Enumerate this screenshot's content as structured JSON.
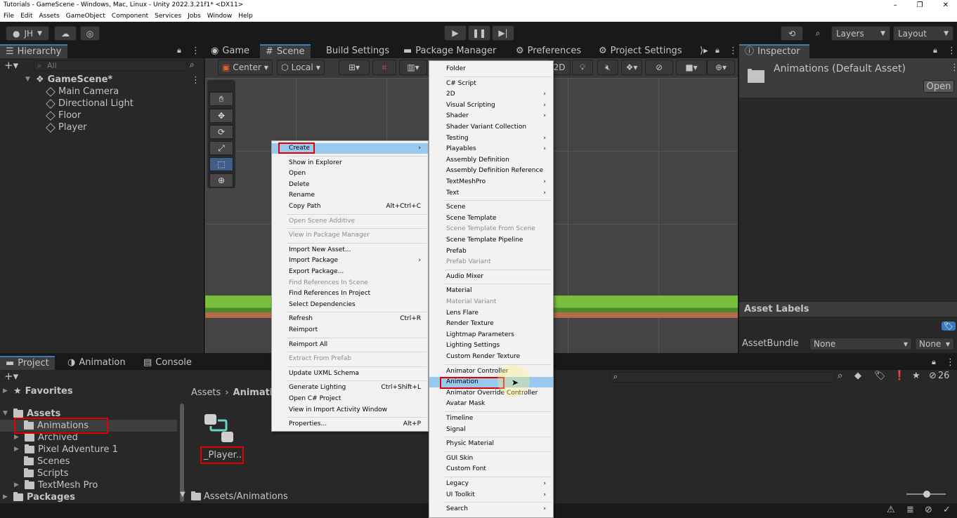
{
  "window": {
    "title": "Tutorials - GameScene - Windows, Mac, Linux - Unity 2022.3.21f1* <DX11>",
    "controls": [
      "–",
      "❐",
      "✕"
    ]
  },
  "menubar": [
    "File",
    "Edit",
    "Assets",
    "GameObject",
    "Component",
    "Services",
    "Jobs",
    "Window",
    "Help"
  ],
  "toolbar": {
    "account": "JH",
    "layers": "Layers",
    "layout": "Layout"
  },
  "hierarchy": {
    "tab": "Hierarchy",
    "search_placeholder": "All",
    "scene": "GameScene*",
    "items": [
      "Main Camera",
      "Directional Light",
      "Floor",
      "Player"
    ]
  },
  "center_tabs": [
    "Game",
    "Scene",
    "Build Settings",
    "Package Manager",
    "Preferences",
    "Project Settings"
  ],
  "scene_toolbar": {
    "pivot": "Center",
    "space": "Local",
    "mode2d": "2D"
  },
  "inspector": {
    "tab": "Inspector",
    "asset_title": "Animations (Default Asset)",
    "open_button": "Open",
    "asset_labels": "Asset Labels",
    "asset_bundle_label": "AssetBundle",
    "bundle_value": "None",
    "variant_value": "None"
  },
  "bottom_tabs": [
    "Project",
    "Animation",
    "Console"
  ],
  "project": {
    "favorites": "Favorites",
    "assets": "Assets",
    "packages": "Packages",
    "folders": [
      "Animations",
      "Archived",
      "Pixel Adventure 1",
      "Scenes",
      "Scripts",
      "TextMesh Pro"
    ],
    "breadcrumb_root": "Assets",
    "breadcrumb_current": "Animatio",
    "asset_name": "_Player...",
    "footer_path": "Assets/Animations",
    "hidden_count": "26"
  },
  "context_menu": [
    {
      "label": "Create",
      "shortcut": "›",
      "disabled": false,
      "highlight": true
    },
    {
      "sep": true
    },
    {
      "label": "Show in Explorer",
      "shortcut": "",
      "disabled": false
    },
    {
      "label": "Open",
      "shortcut": "",
      "disabled": false
    },
    {
      "label": "Delete",
      "shortcut": "",
      "disabled": false
    },
    {
      "label": "Rename",
      "shortcut": "",
      "disabled": false
    },
    {
      "label": "Copy Path",
      "shortcut": "Alt+Ctrl+C",
      "disabled": false
    },
    {
      "sep": true
    },
    {
      "label": "Open Scene Additive",
      "shortcut": "",
      "disabled": true
    },
    {
      "sep": true
    },
    {
      "label": "View in Package Manager",
      "shortcut": "",
      "disabled": true
    },
    {
      "sep": true
    },
    {
      "label": "Import New Asset...",
      "shortcut": "",
      "disabled": false
    },
    {
      "label": "Import Package",
      "shortcut": "›",
      "disabled": false
    },
    {
      "label": "Export Package...",
      "shortcut": "",
      "disabled": false
    },
    {
      "label": "Find References In Scene",
      "shortcut": "",
      "disabled": true
    },
    {
      "label": "Find References In Project",
      "shortcut": "",
      "disabled": false
    },
    {
      "label": "Select Dependencies",
      "shortcut": "",
      "disabled": false
    },
    {
      "sep": true
    },
    {
      "label": "Refresh",
      "shortcut": "Ctrl+R",
      "disabled": false
    },
    {
      "label": "Reimport",
      "shortcut": "",
      "disabled": false
    },
    {
      "sep": true
    },
    {
      "label": "Reimport All",
      "shortcut": "",
      "disabled": false
    },
    {
      "sep": true
    },
    {
      "label": "Extract From Prefab",
      "shortcut": "",
      "disabled": true
    },
    {
      "sep": true
    },
    {
      "label": "Update UXML Schema",
      "shortcut": "",
      "disabled": false
    },
    {
      "sep": true
    },
    {
      "label": "Generate Lighting",
      "shortcut": "Ctrl+Shift+L",
      "disabled": false
    },
    {
      "label": "Open C# Project",
      "shortcut": "",
      "disabled": false
    },
    {
      "label": "View in Import Activity Window",
      "shortcut": "",
      "disabled": false
    },
    {
      "sep": true
    },
    {
      "label": "Properties...",
      "shortcut": "Alt+P",
      "disabled": false
    }
  ],
  "create_menu": [
    {
      "label": "Folder",
      "arrow": false,
      "disabled": false
    },
    {
      "sep": true
    },
    {
      "label": "C# Script",
      "arrow": false,
      "disabled": false
    },
    {
      "label": "2D",
      "arrow": true,
      "disabled": false
    },
    {
      "label": "Visual Scripting",
      "arrow": true,
      "disabled": false
    },
    {
      "label": "Shader",
      "arrow": true,
      "disabled": false
    },
    {
      "label": "Shader Variant Collection",
      "arrow": false,
      "disabled": false
    },
    {
      "label": "Testing",
      "arrow": true,
      "disabled": false
    },
    {
      "label": "Playables",
      "arrow": true,
      "disabled": false
    },
    {
      "label": "Assembly Definition",
      "arrow": false,
      "disabled": false
    },
    {
      "label": "Assembly Definition Reference",
      "arrow": false,
      "disabled": false
    },
    {
      "label": "TextMeshPro",
      "arrow": true,
      "disabled": false
    },
    {
      "label": "Text",
      "arrow": true,
      "disabled": false
    },
    {
      "sep": true
    },
    {
      "label": "Scene",
      "arrow": false,
      "disabled": false
    },
    {
      "label": "Scene Template",
      "arrow": false,
      "disabled": false
    },
    {
      "label": "Scene Template From Scene",
      "arrow": false,
      "disabled": true
    },
    {
      "label": "Scene Template Pipeline",
      "arrow": false,
      "disabled": false
    },
    {
      "label": "Prefab",
      "arrow": false,
      "disabled": false
    },
    {
      "label": "Prefab Variant",
      "arrow": false,
      "disabled": true
    },
    {
      "sep": true
    },
    {
      "label": "Audio Mixer",
      "arrow": false,
      "disabled": false
    },
    {
      "sep": true
    },
    {
      "label": "Material",
      "arrow": false,
      "disabled": false
    },
    {
      "label": "Material Variant",
      "arrow": false,
      "disabled": true
    },
    {
      "label": "Lens Flare",
      "arrow": false,
      "disabled": false
    },
    {
      "label": "Render Texture",
      "arrow": false,
      "disabled": false
    },
    {
      "label": "Lightmap Parameters",
      "arrow": false,
      "disabled": false
    },
    {
      "label": "Lighting Settings",
      "arrow": false,
      "disabled": false
    },
    {
      "label": "Custom Render Texture",
      "arrow": false,
      "disabled": false
    },
    {
      "sep": true
    },
    {
      "label": "Animator Controller",
      "arrow": false,
      "disabled": false
    },
    {
      "label": "Animation",
      "arrow": false,
      "disabled": false,
      "highlight": true
    },
    {
      "label": "Animator Override Controller",
      "arrow": false,
      "disabled": false
    },
    {
      "label": "Avatar Mask",
      "arrow": false,
      "disabled": false
    },
    {
      "sep": true
    },
    {
      "label": "Timeline",
      "arrow": false,
      "disabled": false
    },
    {
      "label": "Signal",
      "arrow": false,
      "disabled": false
    },
    {
      "sep": true
    },
    {
      "label": "Physic Material",
      "arrow": false,
      "disabled": false
    },
    {
      "sep": true
    },
    {
      "label": "GUI Skin",
      "arrow": false,
      "disabled": false
    },
    {
      "label": "Custom Font",
      "arrow": false,
      "disabled": false
    },
    {
      "sep": true
    },
    {
      "label": "Legacy",
      "arrow": true,
      "disabled": false
    },
    {
      "label": "UI Toolkit",
      "arrow": true,
      "disabled": false
    },
    {
      "sep": true
    },
    {
      "label": "Search",
      "arrow": true,
      "disabled": false
    }
  ]
}
